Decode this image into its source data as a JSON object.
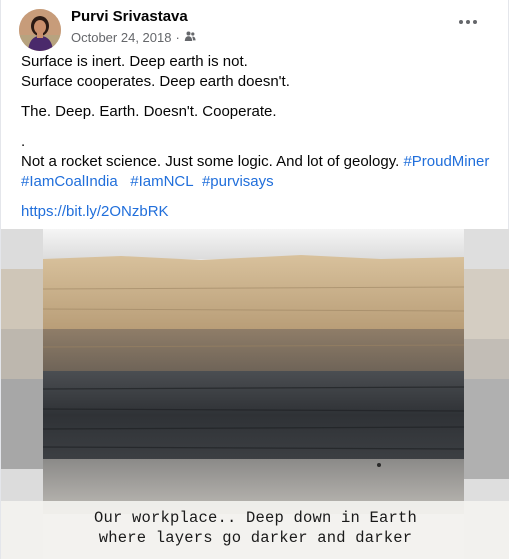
{
  "post": {
    "author": "Purvi Srivastava",
    "date": "October 24, 2018",
    "privacy_icon": "friends-icon",
    "more_icon": "more-options-icon"
  },
  "body": {
    "line1": "Surface is inert. Deep earth is not.",
    "line2": "Surface cooperates. Deep earth doesn't.",
    "line3": "The. Deep. Earth. Doesn't. Cooperate.",
    "line4": ".",
    "line5": "Not a rocket science. Just some logic. And lot of geology.",
    "hashtags_line1": [
      "#ProudMiner"
    ],
    "hashtags_line2": [
      "#IamCoalIndia",
      "#IamNCL",
      "#purvisays"
    ],
    "link": "https://bit.ly/2ONzbRK"
  },
  "image": {
    "caption_line1": "Our workplace.. Deep down in Earth",
    "caption_line2": "where layers go darker and darker"
  }
}
